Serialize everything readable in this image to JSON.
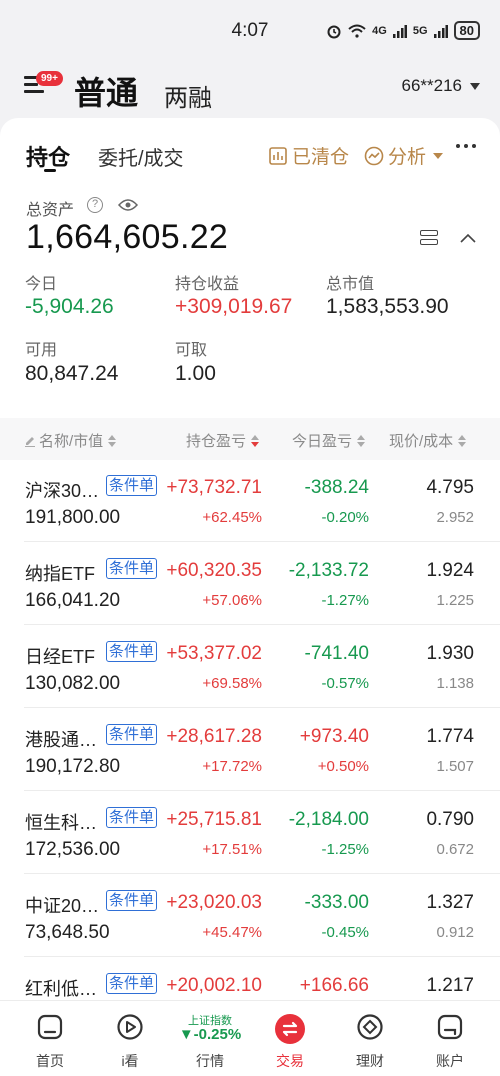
{
  "status_bar": {
    "time": "4:07",
    "network_1": "4G",
    "network_2": "5G",
    "battery": "80"
  },
  "header": {
    "badge": "99+",
    "account_type": "普通",
    "account_sub": "两融",
    "account_id": "66**216"
  },
  "tabs": {
    "holdings": "持仓",
    "orders": "委托/成交",
    "cleared": "已清仓",
    "analysis": "分析"
  },
  "summary": {
    "total_label": "总资产",
    "total_value": "1,664,605.22",
    "today_label": "今日",
    "today_value": "-5,904.26",
    "pnl_label": "持仓收益",
    "pnl_value": "+309,019.67",
    "mv_label": "总市值",
    "mv_value": "1,583,553.90",
    "available_label": "可用",
    "available_value": "80,847.24",
    "withdrawable_label": "可取",
    "withdrawable_value": "1.00"
  },
  "list_header": {
    "name_mv": "名称/市值",
    "pnl": "持仓盈亏",
    "today_pnl": "今日盈亏",
    "price_cost": "现价/成本"
  },
  "positions": [
    {
      "name": "沪深30…",
      "tag": "条件单",
      "market_value": "191,800.00",
      "pnl": "+73,732.71",
      "pnl_pct": "+62.45%",
      "day_pnl": "-388.24",
      "day_pct": "-0.20%",
      "price": "4.795",
      "cost": "2.952",
      "pnl_dir": "up",
      "day_dir": "down"
    },
    {
      "name": "纳指ETF",
      "tag": "条件单",
      "market_value": "166,041.20",
      "pnl": "+60,320.35",
      "pnl_pct": "+57.06%",
      "day_pnl": "-2,133.72",
      "day_pct": "-1.27%",
      "price": "1.924",
      "cost": "1.225",
      "pnl_dir": "up",
      "day_dir": "down"
    },
    {
      "name": "日经ETF",
      "tag": "条件单",
      "market_value": "130,082.00",
      "pnl": "+53,377.02",
      "pnl_pct": "+69.58%",
      "day_pnl": "-741.40",
      "day_pct": "-0.57%",
      "price": "1.930",
      "cost": "1.138",
      "pnl_dir": "up",
      "day_dir": "down"
    },
    {
      "name": "港股通…",
      "tag": "条件单",
      "market_value": "190,172.80",
      "pnl": "+28,617.28",
      "pnl_pct": "+17.72%",
      "day_pnl": "+973.40",
      "day_pct": "+0.50%",
      "price": "1.774",
      "cost": "1.507",
      "pnl_dir": "up",
      "day_dir": "up"
    },
    {
      "name": "恒生科…",
      "tag": "条件单",
      "market_value": "172,536.00",
      "pnl": "+25,715.81",
      "pnl_pct": "+17.51%",
      "day_pnl": "-2,184.00",
      "day_pct": "-1.25%",
      "price": "0.790",
      "cost": "0.672",
      "pnl_dir": "up",
      "day_dir": "down"
    },
    {
      "name": "中证20…",
      "tag": "条件单",
      "market_value": "73,648.50",
      "pnl": "+23,020.03",
      "pnl_pct": "+45.47%",
      "day_pnl": "-333.00",
      "day_pct": "-0.45%",
      "price": "1.327",
      "cost": "0.912",
      "pnl_dir": "up",
      "day_dir": "down"
    },
    {
      "name": "红利低…",
      "tag": "条件单",
      "market_value": "",
      "pnl": "+20,002.10",
      "pnl_pct": "",
      "day_pnl": "+166.66",
      "day_pct": "",
      "price": "1.217",
      "cost": "",
      "pnl_dir": "up",
      "day_dir": "up"
    }
  ],
  "bottom_nav": {
    "home": "首页",
    "watch": "i看",
    "index_name": "上证指数",
    "index_change": "▼-0.25%",
    "market": "行情",
    "trade": "交易",
    "wealth": "理财",
    "account": "账户"
  },
  "colors": {
    "up": "#e33c3c",
    "down": "#17994f",
    "accent_gold": "#b8874a",
    "tag_blue": "#2f6fd6"
  }
}
